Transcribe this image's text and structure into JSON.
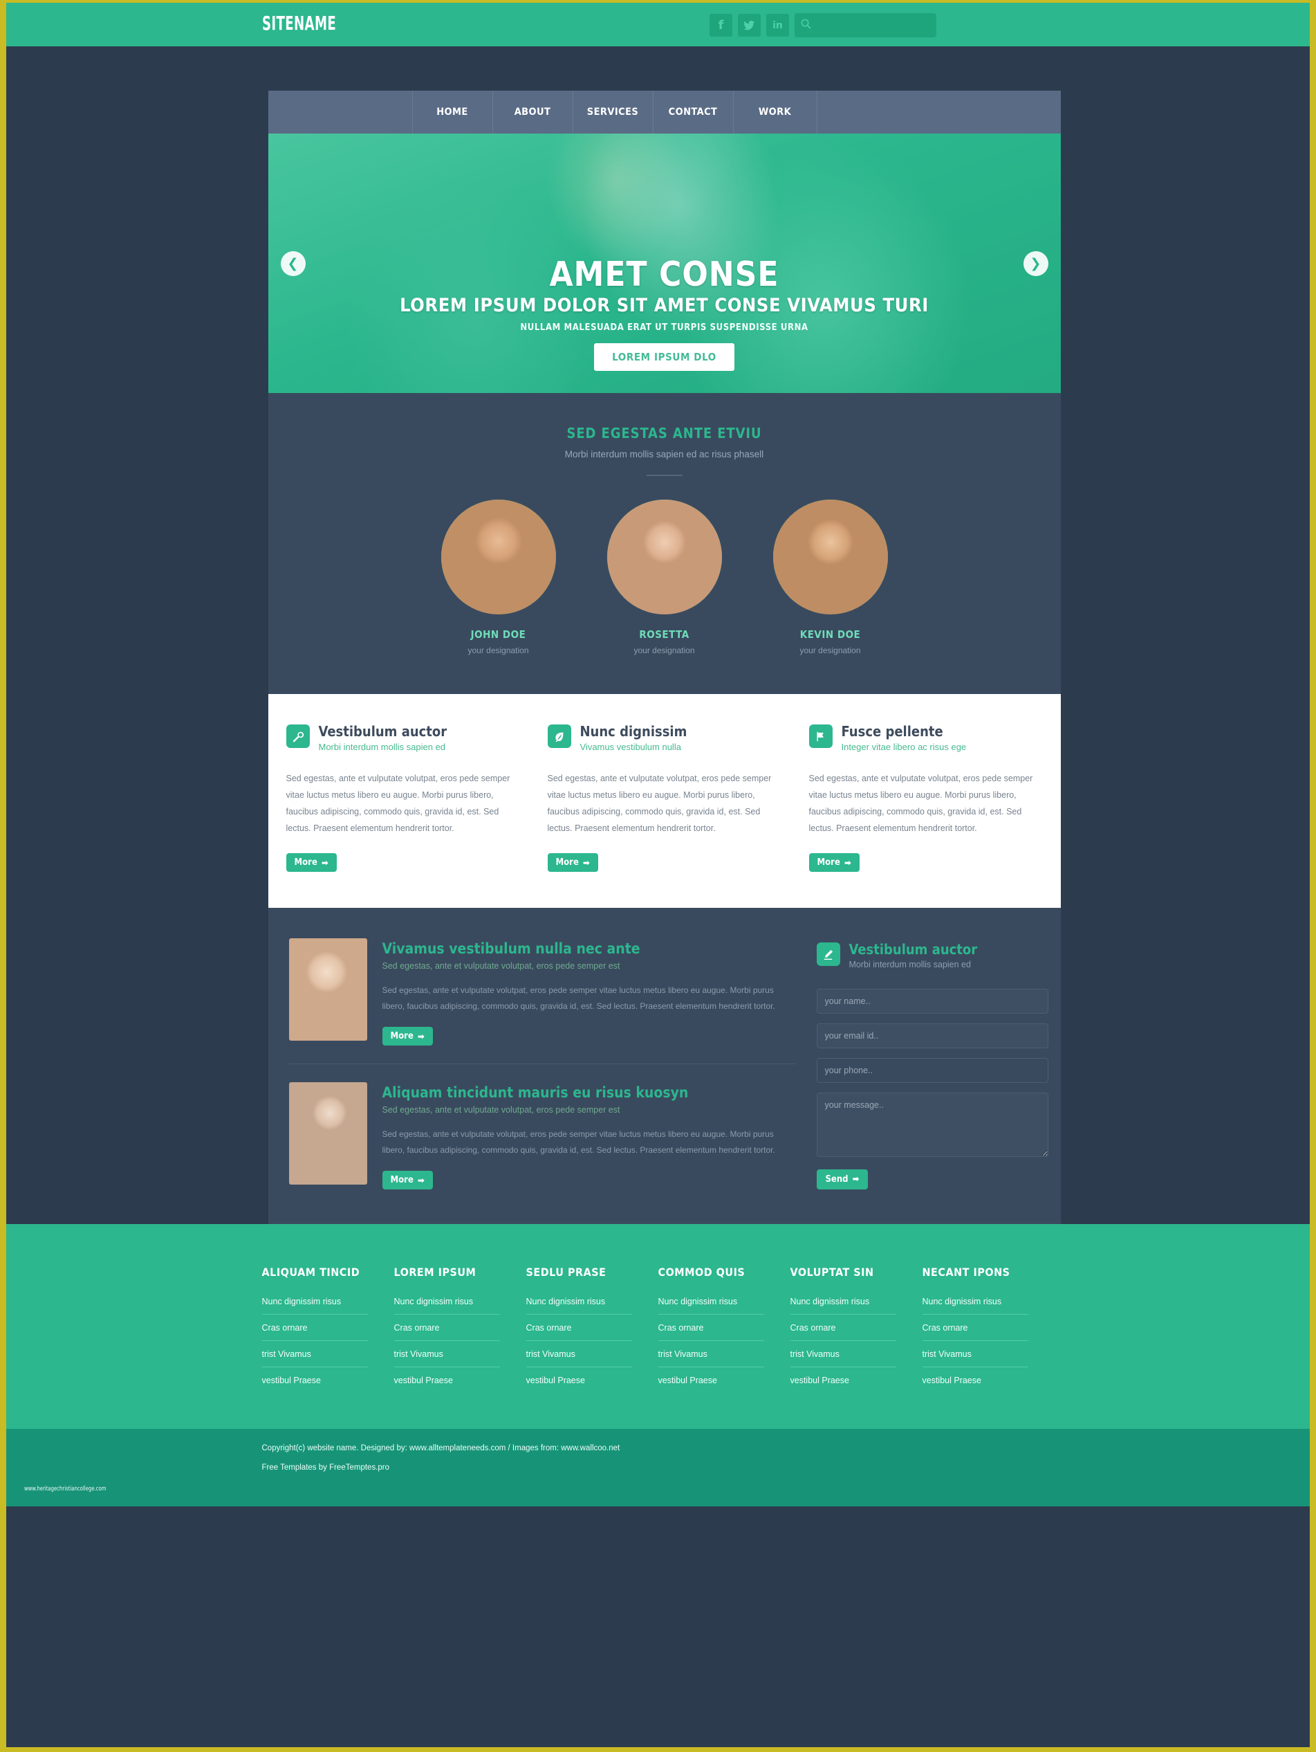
{
  "header": {
    "logo": "SITENAME",
    "social": [
      {
        "name": "facebook-icon",
        "glyph": "f"
      },
      {
        "name": "twitter-icon",
        "glyph": "ᵥ"
      },
      {
        "name": "linkedin-icon",
        "glyph": "in"
      }
    ],
    "search_placeholder": "",
    "search_value": ""
  },
  "nav": {
    "items": [
      "HOME",
      "ABOUT",
      "SERVICES",
      "CONTACT",
      "WORK"
    ]
  },
  "hero": {
    "title": "AMET CONSE",
    "subtitle": "LOREM IPSUM DOLOR SIT AMET CONSE VIVAMUS TURI",
    "tagline": "NULLAM MALESUADA ERAT UT TURPIS SUSPENDISSE URNA",
    "button": "LOREM IPSUM DLO",
    "prev": "❮",
    "next": "❯"
  },
  "team": {
    "title": "SED EGESTAS ANTE ETVIU",
    "subtitle": "Morbi interdum mollis sapien ed ac risus phasell",
    "members": [
      {
        "name": "JOHN DOE",
        "designation": "your designation"
      },
      {
        "name": "ROSETTA",
        "designation": "your designation"
      },
      {
        "name": "KEVIN DOE",
        "designation": "your designation"
      }
    ]
  },
  "services": {
    "body": "Sed egestas, ante et vulputate volutpat, eros pede semper vitae luctus metus libero eu augue. Morbi purus libero, faucibus adipiscing, commodo quis, gravida id, est. Sed lectus. Praesent elementum hendrerit tortor.",
    "more_label": "More",
    "more_arrow": "➡",
    "items": [
      {
        "title": "Vestibulum auctor",
        "subtitle": "Morbi interdum mollis sapien ed",
        "icon": "wrench-icon",
        "glyph": "🔧"
      },
      {
        "title": "Nunc dignissim",
        "subtitle": "Vivamus vestibulum nulla",
        "icon": "leaf-icon",
        "glyph": "❦"
      },
      {
        "title": "Fusce pellente",
        "subtitle": "Integer vitae libero ac risus ege",
        "icon": "flag-icon",
        "glyph": "⚑"
      }
    ]
  },
  "blog": {
    "more_label": "More",
    "more_arrow": "➡",
    "posts": [
      {
        "title": "Vivamus vestibulum nulla nec ante",
        "subtitle": "Sed egestas, ante et vulputate volutpat, eros pede semper est",
        "body": "Sed egestas, ante et vulputate volutpat, eros pede semper vitae luctus metus libero eu augue. Morbi purus libero, faucibus adipiscing, commodo quis, gravida id, est. Sed lectus. Praesent elementum hendrerit tortor.",
        "thumb": "woman-short-red-hair-photo"
      },
      {
        "title": "Aliquam tincidunt mauris eu risus kuosyn",
        "subtitle": "Sed egestas, ante et vulputate volutpat, eros pede semper est",
        "body": "Sed egestas, ante et vulputate volutpat, eros pede semper vitae luctus metus libero eu augue. Morbi purus libero, faucibus adipiscing, commodo quis, gravida id, est. Sed lectus. Praesent elementum hendrerit tortor.",
        "thumb": "woman-white-scarf-photo"
      }
    ]
  },
  "contact": {
    "title": "Vestibulum auctor",
    "subtitle": "Morbi interdum mollis sapien ed",
    "icon": "pencil-icon",
    "glyph": "✎",
    "name_placeholder": "your name..",
    "email_placeholder": "your email id..",
    "phone_placeholder": "your phone..",
    "message_placeholder": "your message..",
    "send_label": "Send",
    "send_arrow": "➡"
  },
  "footer": {
    "columns": [
      {
        "heading": "ALIQUAM TINCID",
        "links": [
          "Nunc dignissim risus",
          "Cras ornare",
          "trist Vivamus",
          "vestibul Praese"
        ]
      },
      {
        "heading": "LOREM IPSUM",
        "links": [
          "Nunc dignissim risus",
          "Cras ornare",
          "trist Vivamus",
          "vestibul Praese"
        ]
      },
      {
        "heading": "SEDLU PRASE",
        "links": [
          "Nunc dignissim risus",
          "Cras ornare",
          "trist Vivamus",
          "vestibul Praese"
        ]
      },
      {
        "heading": "COMMOD QUIS",
        "links": [
          "Nunc dignissim risus",
          "Cras ornare",
          "trist Vivamus",
          "vestibul Praese"
        ]
      },
      {
        "heading": "VOLUPTAT SIN",
        "links": [
          "Nunc dignissim risus",
          "Cras ornare",
          "trist Vivamus",
          "vestibul Praese"
        ]
      },
      {
        "heading": "NECANT IPONS",
        "links": [
          "Nunc dignissim risus",
          "Cras ornare",
          "trist Vivamus",
          "vestibul Praese"
        ]
      }
    ],
    "copyright_line1": "Copyright(c) website name. Designed by: www.alltemplateneeds.com / Images from: www.wallcoo.net",
    "copyright_line2": "Free Templates by FreeTemptes.pro",
    "watermark": "www.heritagechristiancollege.com"
  },
  "colors": {
    "accent": "#2cb78e",
    "dark": "#2d3b4e",
    "panel": "#3a4a5e",
    "nav": "#5a6b85",
    "border": "#c9bb24",
    "copy_bg": "#179478"
  }
}
